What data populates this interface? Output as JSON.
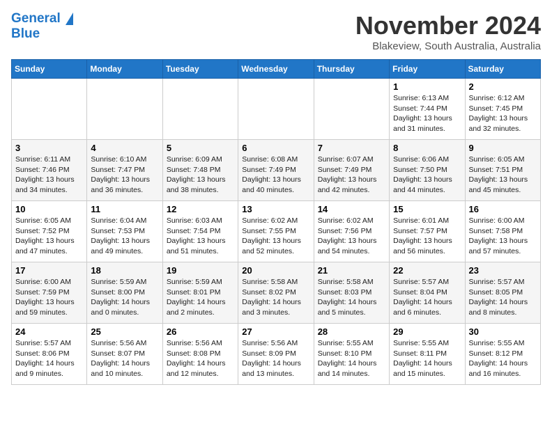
{
  "header": {
    "logo_line1": "General",
    "logo_line2": "Blue",
    "month": "November 2024",
    "location": "Blakeview, South Australia, Australia"
  },
  "columns": [
    "Sunday",
    "Monday",
    "Tuesday",
    "Wednesday",
    "Thursday",
    "Friday",
    "Saturday"
  ],
  "weeks": [
    [
      {
        "day": "",
        "info": ""
      },
      {
        "day": "",
        "info": ""
      },
      {
        "day": "",
        "info": ""
      },
      {
        "day": "",
        "info": ""
      },
      {
        "day": "",
        "info": ""
      },
      {
        "day": "1",
        "info": "Sunrise: 6:13 AM\nSunset: 7:44 PM\nDaylight: 13 hours and 31 minutes."
      },
      {
        "day": "2",
        "info": "Sunrise: 6:12 AM\nSunset: 7:45 PM\nDaylight: 13 hours and 32 minutes."
      }
    ],
    [
      {
        "day": "3",
        "info": "Sunrise: 6:11 AM\nSunset: 7:46 PM\nDaylight: 13 hours and 34 minutes."
      },
      {
        "day": "4",
        "info": "Sunrise: 6:10 AM\nSunset: 7:47 PM\nDaylight: 13 hours and 36 minutes."
      },
      {
        "day": "5",
        "info": "Sunrise: 6:09 AM\nSunset: 7:48 PM\nDaylight: 13 hours and 38 minutes."
      },
      {
        "day": "6",
        "info": "Sunrise: 6:08 AM\nSunset: 7:49 PM\nDaylight: 13 hours and 40 minutes."
      },
      {
        "day": "7",
        "info": "Sunrise: 6:07 AM\nSunset: 7:49 PM\nDaylight: 13 hours and 42 minutes."
      },
      {
        "day": "8",
        "info": "Sunrise: 6:06 AM\nSunset: 7:50 PM\nDaylight: 13 hours and 44 minutes."
      },
      {
        "day": "9",
        "info": "Sunrise: 6:05 AM\nSunset: 7:51 PM\nDaylight: 13 hours and 45 minutes."
      }
    ],
    [
      {
        "day": "10",
        "info": "Sunrise: 6:05 AM\nSunset: 7:52 PM\nDaylight: 13 hours and 47 minutes."
      },
      {
        "day": "11",
        "info": "Sunrise: 6:04 AM\nSunset: 7:53 PM\nDaylight: 13 hours and 49 minutes."
      },
      {
        "day": "12",
        "info": "Sunrise: 6:03 AM\nSunset: 7:54 PM\nDaylight: 13 hours and 51 minutes."
      },
      {
        "day": "13",
        "info": "Sunrise: 6:02 AM\nSunset: 7:55 PM\nDaylight: 13 hours and 52 minutes."
      },
      {
        "day": "14",
        "info": "Sunrise: 6:02 AM\nSunset: 7:56 PM\nDaylight: 13 hours and 54 minutes."
      },
      {
        "day": "15",
        "info": "Sunrise: 6:01 AM\nSunset: 7:57 PM\nDaylight: 13 hours and 56 minutes."
      },
      {
        "day": "16",
        "info": "Sunrise: 6:00 AM\nSunset: 7:58 PM\nDaylight: 13 hours and 57 minutes."
      }
    ],
    [
      {
        "day": "17",
        "info": "Sunrise: 6:00 AM\nSunset: 7:59 PM\nDaylight: 13 hours and 59 minutes."
      },
      {
        "day": "18",
        "info": "Sunrise: 5:59 AM\nSunset: 8:00 PM\nDaylight: 14 hours and 0 minutes."
      },
      {
        "day": "19",
        "info": "Sunrise: 5:59 AM\nSunset: 8:01 PM\nDaylight: 14 hours and 2 minutes."
      },
      {
        "day": "20",
        "info": "Sunrise: 5:58 AM\nSunset: 8:02 PM\nDaylight: 14 hours and 3 minutes."
      },
      {
        "day": "21",
        "info": "Sunrise: 5:58 AM\nSunset: 8:03 PM\nDaylight: 14 hours and 5 minutes."
      },
      {
        "day": "22",
        "info": "Sunrise: 5:57 AM\nSunset: 8:04 PM\nDaylight: 14 hours and 6 minutes."
      },
      {
        "day": "23",
        "info": "Sunrise: 5:57 AM\nSunset: 8:05 PM\nDaylight: 14 hours and 8 minutes."
      }
    ],
    [
      {
        "day": "24",
        "info": "Sunrise: 5:57 AM\nSunset: 8:06 PM\nDaylight: 14 hours and 9 minutes."
      },
      {
        "day": "25",
        "info": "Sunrise: 5:56 AM\nSunset: 8:07 PM\nDaylight: 14 hours and 10 minutes."
      },
      {
        "day": "26",
        "info": "Sunrise: 5:56 AM\nSunset: 8:08 PM\nDaylight: 14 hours and 12 minutes."
      },
      {
        "day": "27",
        "info": "Sunrise: 5:56 AM\nSunset: 8:09 PM\nDaylight: 14 hours and 13 minutes."
      },
      {
        "day": "28",
        "info": "Sunrise: 5:55 AM\nSunset: 8:10 PM\nDaylight: 14 hours and 14 minutes."
      },
      {
        "day": "29",
        "info": "Sunrise: 5:55 AM\nSunset: 8:11 PM\nDaylight: 14 hours and 15 minutes."
      },
      {
        "day": "30",
        "info": "Sunrise: 5:55 AM\nSunset: 8:12 PM\nDaylight: 14 hours and 16 minutes."
      }
    ]
  ]
}
